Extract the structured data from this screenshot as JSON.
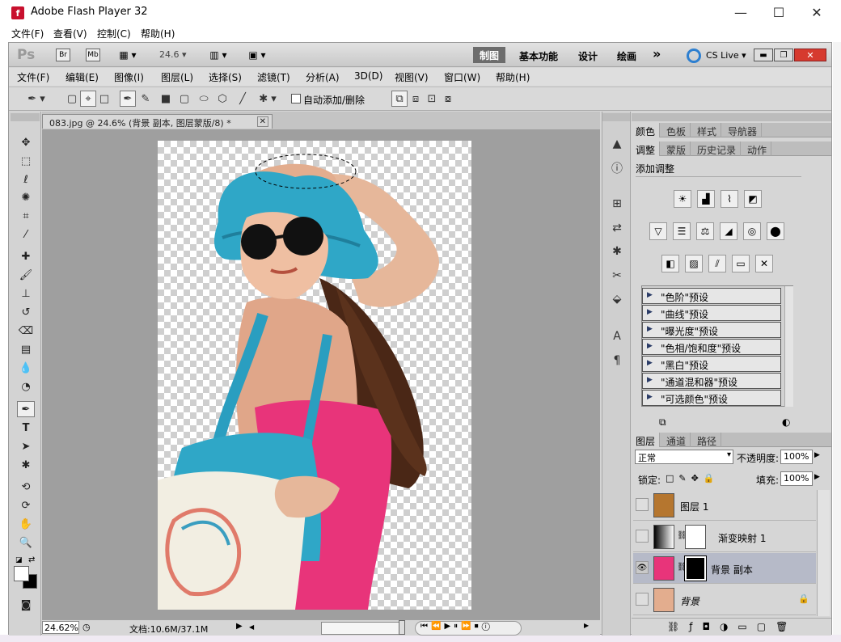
{
  "window": {
    "title": "Adobe Flash Player 32",
    "app_icon": "f",
    "minimize": "—",
    "maximize": "☐",
    "close": "✕"
  },
  "flash_menu": [
    "文件(F)",
    "查看(V)",
    "控制(C)",
    "帮助(H)"
  ],
  "appbar": {
    "ps_logo": "Ps",
    "br": "Br",
    "mb": "Mb",
    "zoom": "24.6",
    "workspaces": [
      "制图",
      "基本功能",
      "设计",
      "绘画"
    ],
    "more": "»",
    "cs_live": "CS Live"
  },
  "menubar": [
    "文件(F)",
    "编辑(E)",
    "图像(I)",
    "图层(L)",
    "选择(S)",
    "滤镜(T)",
    "分析(A)",
    "3D(D)",
    "视图(V)",
    "窗口(W)",
    "帮助(H)"
  ],
  "options": {
    "auto_add_delete": "自动添加/删除"
  },
  "document": {
    "tab_title": "083.jpg @ 24.6% (背景 副本, 图层蒙版/8) *",
    "zoom": "24.62%",
    "doc_size": "文档:10.6M/37.1M"
  },
  "panels": {
    "top_tabs": [
      "颜色",
      "色板",
      "样式",
      "导航器"
    ],
    "adj_tabs": [
      "调整",
      "蒙版",
      "历史记录",
      "动作"
    ],
    "add_adjustment": "添加调整",
    "presets": [
      "\"色阶\"预设",
      "\"曲线\"预设",
      "\"曝光度\"预设",
      "\"色相/饱和度\"预设",
      "\"黑白\"预设",
      "\"通道混和器\"预设",
      "\"可选颜色\"预设"
    ],
    "layer_tabs": [
      "图层",
      "通道",
      "路径"
    ],
    "blend_mode": "正常",
    "opacity_label": "不透明度:",
    "opacity": "100%",
    "lock_label": "锁定:",
    "fill_label": "填充:",
    "fill": "100%",
    "layers": [
      "图层 1",
      "渐变映射 1",
      "背景 副本",
      "背景"
    ]
  },
  "colors": {
    "ps_bg": "#d6d6d6",
    "active_layer": "#b6bac8",
    "hat": "#2fa7c7",
    "top": "#e8347a"
  }
}
